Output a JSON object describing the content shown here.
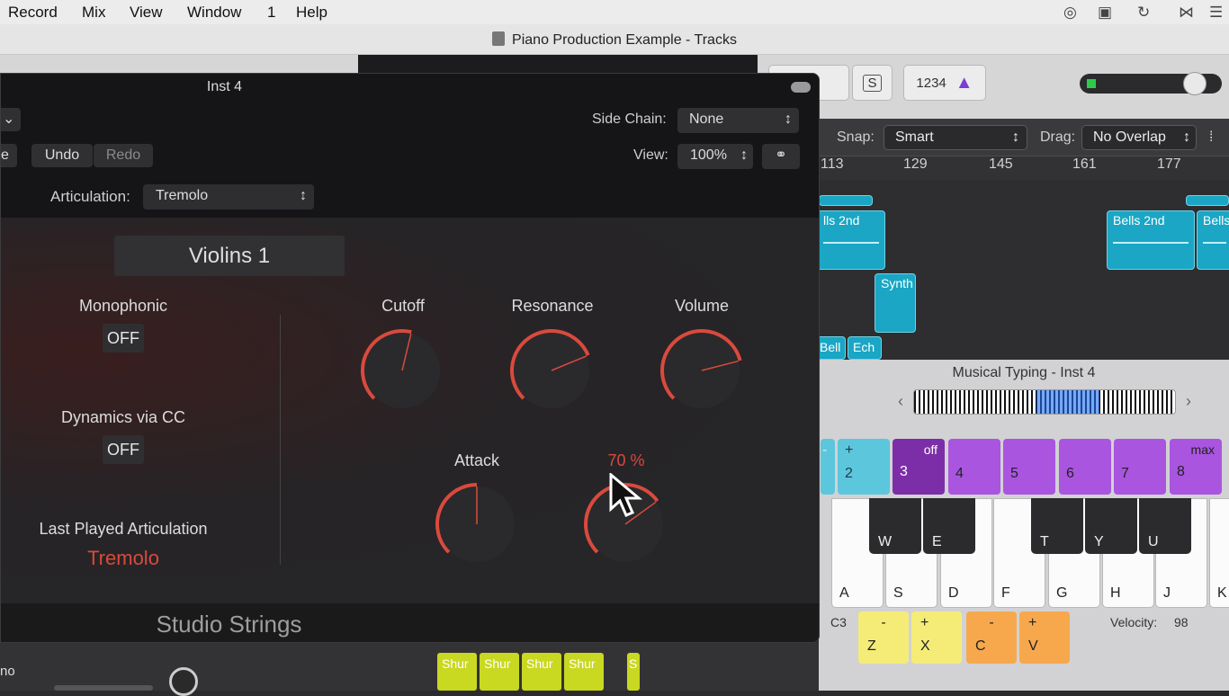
{
  "menubar": {
    "items": [
      "Record",
      "Mix",
      "View",
      "Window",
      "1",
      "Help"
    ]
  },
  "window": {
    "title": "Piano Production Example - Tracks"
  },
  "toolbar": {
    "s_label": "S",
    "counts_label": "1234"
  },
  "tracks": {
    "snap_label": "Snap:",
    "snap_value": "Smart",
    "drag_label": "Drag:",
    "drag_value": "No Overlap",
    "ruler": [
      "113",
      "129",
      "145",
      "161",
      "177"
    ],
    "regions": [
      "lls 2nd",
      "Bells 2nd",
      "Bells",
      "Synth",
      "Bell",
      "Ech"
    ]
  },
  "musical_typing": {
    "title": "Musical Typing - Inst 4",
    "top_keys": [
      {
        "symbol": "-",
        "key": ""
      },
      {
        "symbol": "+",
        "key": "2"
      },
      {
        "symbol": "off",
        "key": "3"
      },
      {
        "symbol": "",
        "key": "4"
      },
      {
        "symbol": "",
        "key": "5"
      },
      {
        "symbol": "",
        "key": "6"
      },
      {
        "symbol": "",
        "key": "7"
      },
      {
        "symbol": "max",
        "key": "8"
      }
    ],
    "white_keys": [
      "A",
      "S",
      "D",
      "F",
      "G",
      "H",
      "J",
      "K"
    ],
    "black_keys": [
      "W",
      "E",
      "T",
      "Y",
      "U"
    ],
    "bottom_keys": [
      {
        "symbol": "-",
        "key": "Z"
      },
      {
        "symbol": "+",
        "key": "X"
      },
      {
        "symbol": "-",
        "key": "C"
      },
      {
        "symbol": "+",
        "key": "V"
      }
    ],
    "octave": "C3",
    "velocity_label": "Velocity:",
    "velocity_value": "98",
    "colors": {
      "teal": "#5cc6dd",
      "purple_dark": "#7c2ea8",
      "purple": "#a955e0",
      "yellow": "#f5ec78",
      "orange": "#f7a84d"
    }
  },
  "plugin": {
    "title": "Inst 4",
    "side_chain_label": "Side Chain:",
    "side_chain_value": "None",
    "edit_left": "e",
    "undo": "Undo",
    "redo": "Redo",
    "view_label": "View:",
    "view_value": "100%",
    "articulation_label": "Articulation:",
    "articulation_value": "Tremolo",
    "instrument_name": "Violins 1",
    "monophonic_label": "Monophonic",
    "monophonic_value": "OFF",
    "dynamics_label": "Dynamics via CC",
    "dynamics_value": "OFF",
    "last_played_label": "Last Played Articulation",
    "last_played_value": "Tremolo",
    "knobs": [
      {
        "label": "Cutoff",
        "value": 0.55
      },
      {
        "label": "Resonance",
        "value": 0.75
      },
      {
        "label": "Volume",
        "value": 0.78
      },
      {
        "label": "Attack",
        "value": 0.5
      },
      {
        "label": "70 %",
        "value": 0.7
      }
    ],
    "footer": "Studio Strings",
    "accent": "#d94a3d"
  },
  "mixer": {
    "track_partial": "no",
    "regions": [
      "Shur",
      "Shur",
      "Shur",
      "Shur",
      "S"
    ]
  }
}
